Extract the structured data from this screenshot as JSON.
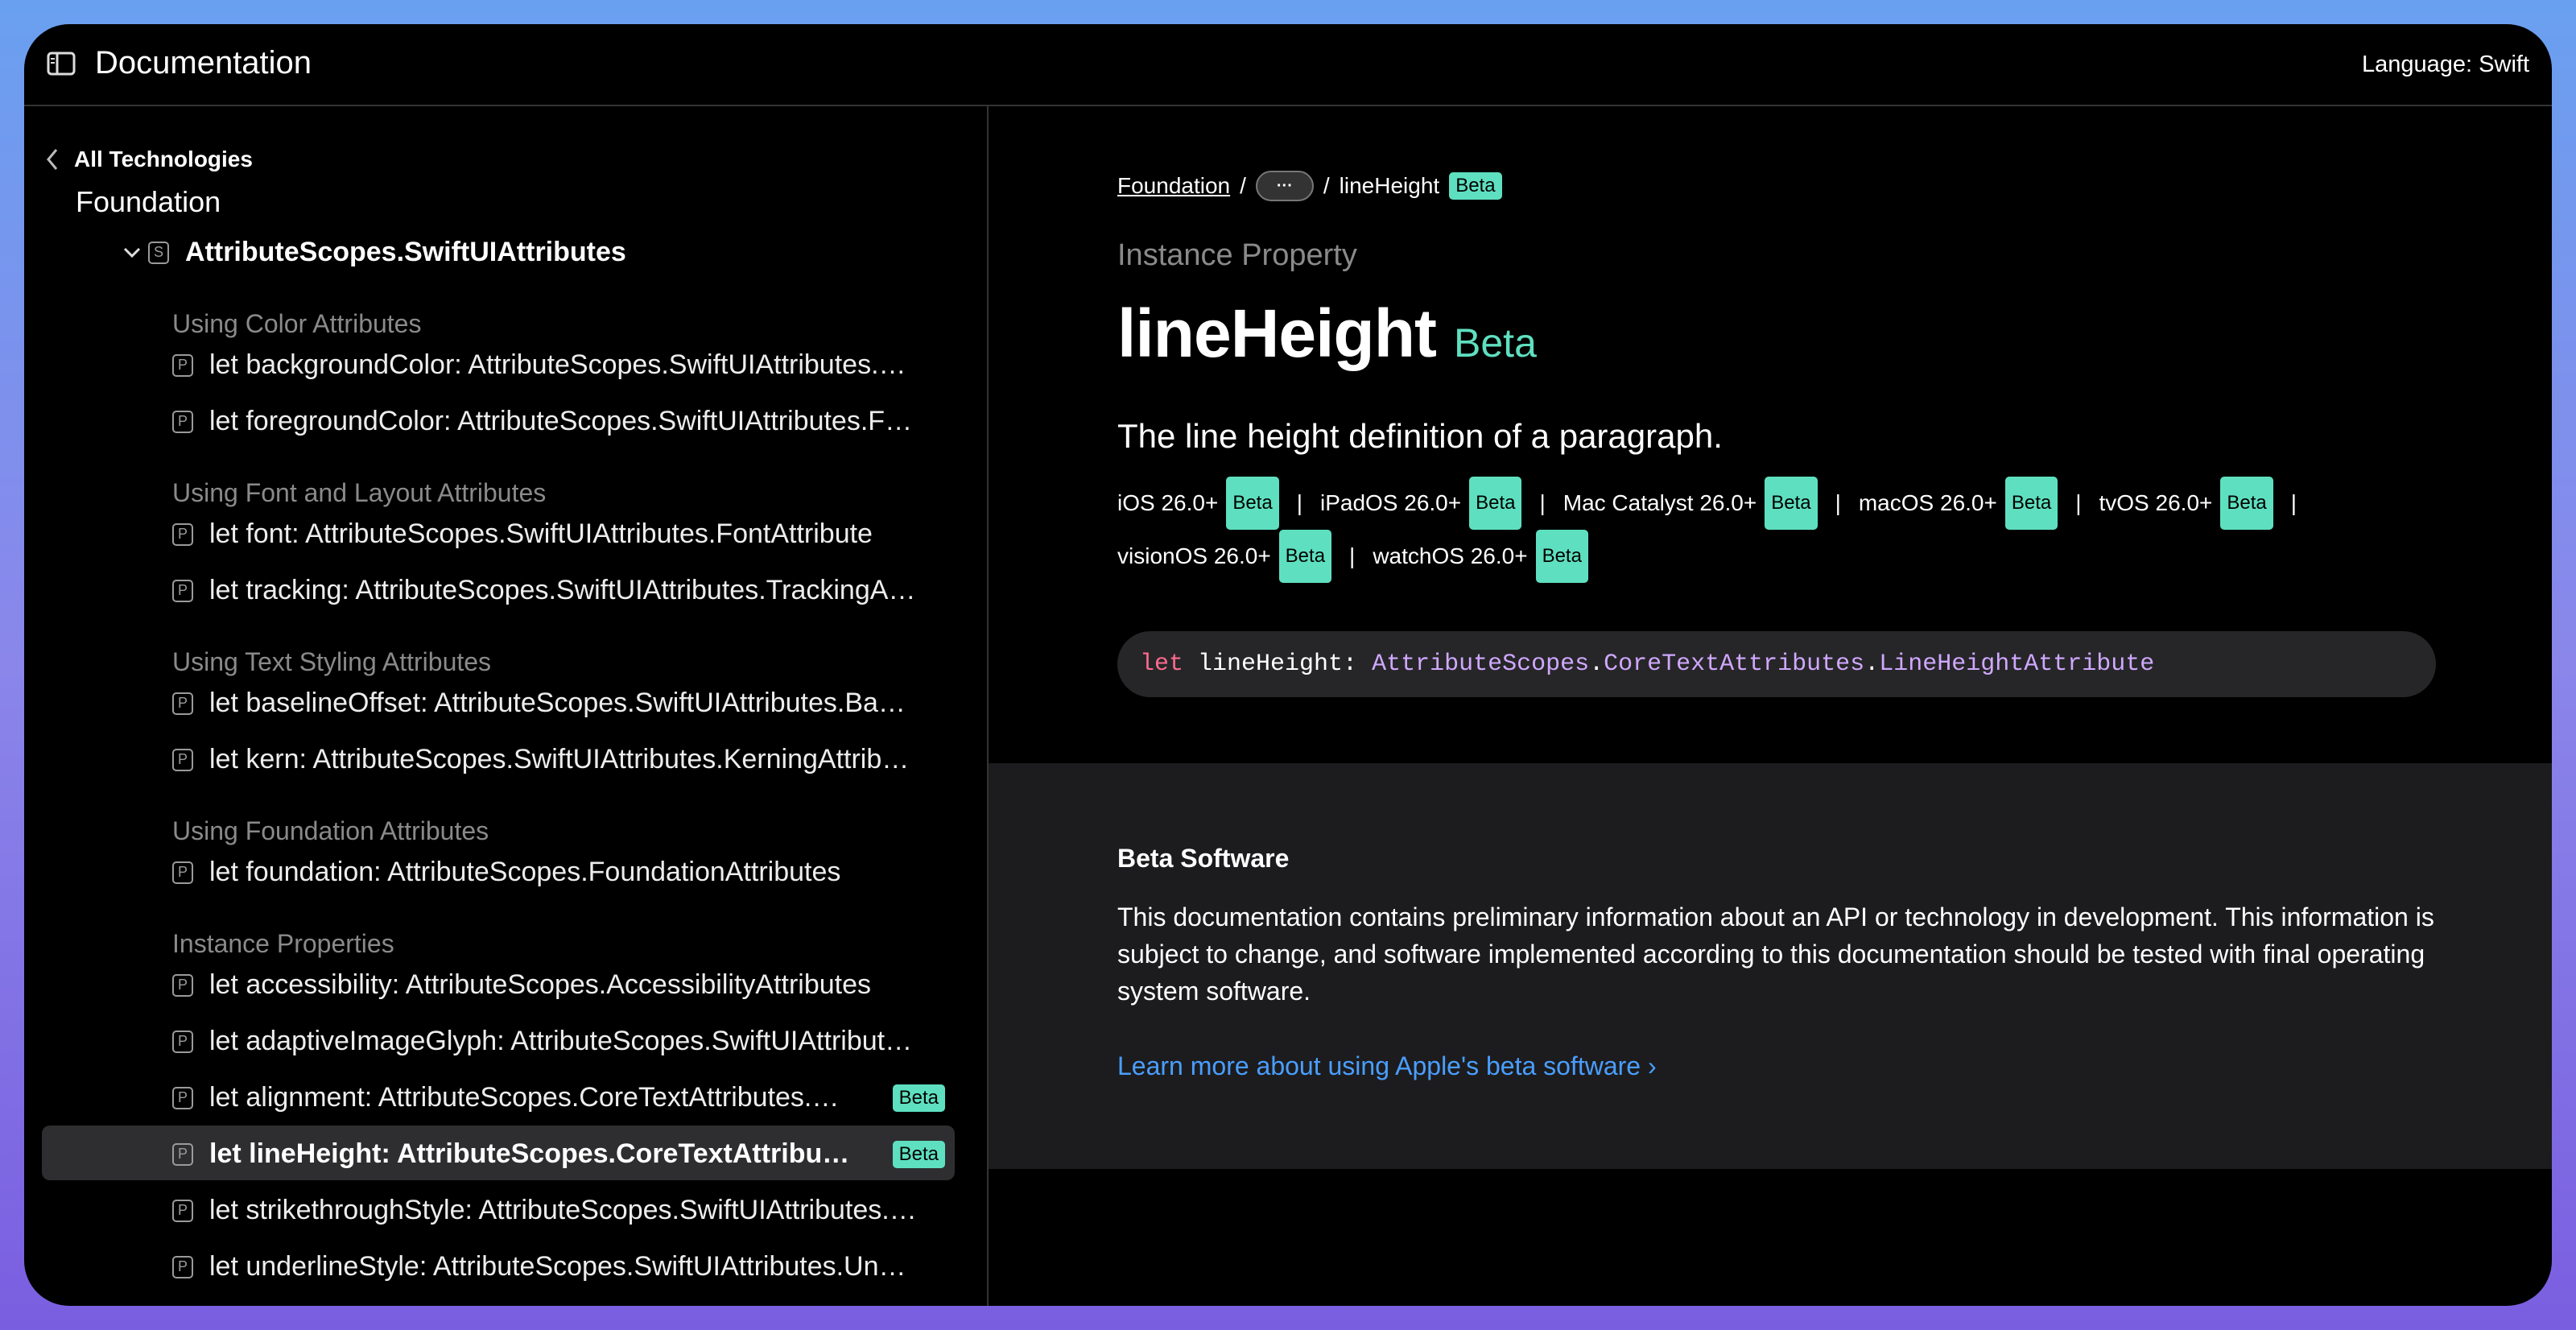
{
  "header": {
    "title": "Documentation",
    "language_label": "Language:",
    "language_value": "Swift"
  },
  "sidebar": {
    "back_label": "All Technologies",
    "framework": "Foundation",
    "type_badge": "S",
    "type_name": "AttributeScopes.SwiftUIAttributes",
    "groups": [
      "Using Color Attributes",
      "Using Font and Layout Attributes",
      "Using Text Styling Attributes",
      "Using Foundation Attributes",
      "Instance Properties"
    ],
    "items": [
      {
        "badge": "P",
        "label": "let backgroundColor: AttributeScopes.SwiftUIAttributes.BackgroundColorAttribute"
      },
      {
        "badge": "P",
        "label": "let foregroundColor: AttributeScopes.SwiftUIAttributes.ForegroundColorAttribute"
      },
      {
        "badge": "P",
        "label": "let font: AttributeScopes.SwiftUIAttributes.FontAttribute"
      },
      {
        "badge": "P",
        "label": "let tracking: AttributeScopes.SwiftUIAttributes.TrackingAttribute"
      },
      {
        "badge": "P",
        "label": "let baselineOffset: AttributeScopes.SwiftUIAttributes.BaselineOffsetAttribute"
      },
      {
        "badge": "P",
        "label": "let kern: AttributeScopes.SwiftUIAttributes.KerningAttribute"
      },
      {
        "badge": "P",
        "label": "let foundation: AttributeScopes.FoundationAttributes"
      },
      {
        "badge": "P",
        "label": "let accessibility: AttributeScopes.AccessibilityAttributes"
      },
      {
        "badge": "P",
        "label": "let adaptiveImageGlyph: AttributeScopes.SwiftUIAttributes.AdaptiveImageGlyphAttribute"
      },
      {
        "badge": "P",
        "label": "let alignment: AttributeScopes.CoreTextAttributes.AlignmentAttribute",
        "beta": "Beta"
      },
      {
        "badge": "P",
        "label": "let lineHeight: AttributeScopes.CoreTextAttributes.LineHeightAttribute",
        "beta": "Beta"
      },
      {
        "badge": "P",
        "label": "let strikethroughStyle: AttributeScopes.SwiftUIAttributes.StrikethroughStyleAttribute"
      },
      {
        "badge": "P",
        "label": "let underlineStyle: AttributeScopes.SwiftUIAttributes.UnderlineStyleAttribute"
      }
    ]
  },
  "main": {
    "breadcrumb": {
      "root": "Foundation",
      "sep": "/",
      "ellipsis": "···",
      "current": "lineHeight",
      "beta": "Beta"
    },
    "kind": "Instance Property",
    "title": "lineHeight",
    "title_beta": "Beta",
    "abstract": "The line height definition of a paragraph.",
    "platforms": [
      {
        "name": "iOS 26.0+",
        "beta": "Beta"
      },
      {
        "name": "iPadOS 26.0+",
        "beta": "Beta"
      },
      {
        "name": "Mac Catalyst 26.0+",
        "beta": "Beta"
      },
      {
        "name": "macOS 26.0+",
        "beta": "Beta"
      },
      {
        "name": "tvOS 26.0+",
        "beta": "Beta"
      },
      {
        "name": "visionOS 26.0+",
        "beta": "Beta"
      },
      {
        "name": "watchOS 26.0+",
        "beta": "Beta"
      }
    ],
    "declaration": {
      "keyword": "let",
      "identifier": "lineHeight:",
      "type1": "AttributeScopes",
      "dot": ".",
      "type2": "CoreTextAttributes",
      "type3": "LineHeightAttribute"
    },
    "note": {
      "title": "Beta Software",
      "body": "This documentation contains preliminary information about an API or technology in development. This information is subject to change, and software implemented according to this documentation should be tested with final operating system software.",
      "link": "Learn more about using Apple's beta software ›"
    }
  },
  "colors": {
    "accent_beta": "#5ee0c0",
    "link": "#4a9eff",
    "keyword": "#fc6a8e",
    "type": "#d0a8ff"
  }
}
